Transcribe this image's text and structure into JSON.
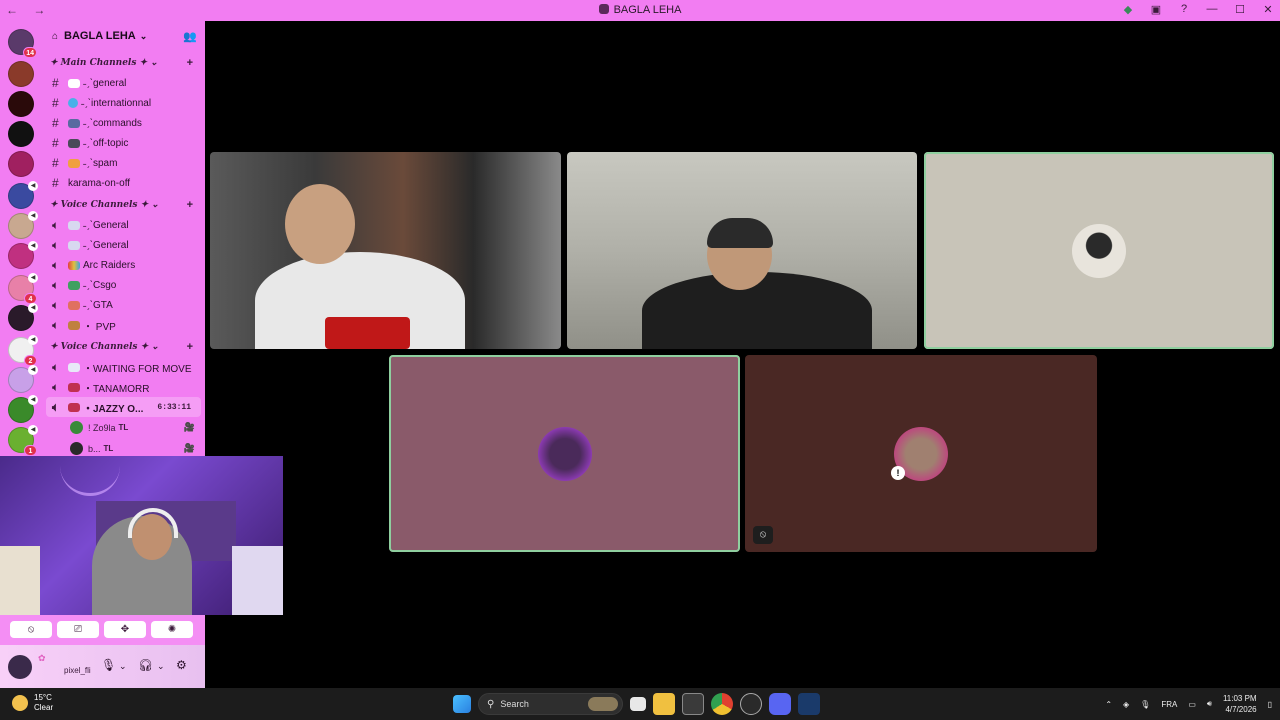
{
  "window": {
    "nav": "← →",
    "title": "BAGLA LEHA",
    "controls": [
      "—",
      "☐",
      "✕"
    ]
  },
  "server": {
    "name": "BAGLA LEHA",
    "categories": [
      {
        "label": "✦ Main Channels ✦ ⌄",
        "channels": [
          {
            "type": "text",
            "name": "˗ˏˋgeneral",
            "emoji_color": "#ffffff"
          },
          {
            "type": "text",
            "name": "˗ˏˋinternationnal",
            "emoji_color": "#4ab0e8"
          },
          {
            "type": "text",
            "name": "˗ˏˋcommands",
            "emoji_color": "#5a6aa0"
          },
          {
            "type": "text",
            "name": "˗ˏˋoff-topic",
            "emoji_color": "#4a4a5a"
          },
          {
            "type": "text",
            "name": "˗ˏˋspam",
            "emoji_color": "#f0a040"
          },
          {
            "type": "text",
            "name": "karama-on-off",
            "emoji_color": ""
          }
        ]
      },
      {
        "label": "✦ Voice Channels ✦ ⌄",
        "channels": [
          {
            "type": "voice",
            "name": "˗ˏˋGeneral",
            "emoji_color": "#d8d8f0"
          },
          {
            "type": "voice",
            "name": "˗ˏˋGeneral",
            "emoji_color": "#d8d8f0"
          },
          {
            "type": "voice",
            "name": " Arc Raiders",
            "emoji_color": "#e0a040"
          },
          {
            "type": "voice",
            "name": "˗ˏˋCsgo",
            "emoji_color": "#40a060"
          },
          {
            "type": "voice",
            "name": "˗ˏˋGTA",
            "emoji_color": "#e07060"
          },
          {
            "type": "voice",
            "name": "・ PVP",
            "emoji_color": "#c08040"
          }
        ]
      },
      {
        "label": "✦ Voice Channels ✦ ⌄",
        "channels": [
          {
            "type": "voice",
            "name": "・WAITING FOR MOVE",
            "emoji_color": "#e8e8f8"
          },
          {
            "type": "voice",
            "name": "・TANAMORR",
            "emoji_color": "#c03050"
          },
          {
            "type": "voice",
            "name": "・JAZZY O...",
            "emoji_color": "#c03050",
            "active": true,
            "timer": "6:33:11"
          }
        ]
      }
    ],
    "voice_users": [
      {
        "name": "! Zo9la",
        "tag": "TL",
        "camera": "🎥"
      },
      {
        "name": "b...",
        "tag": "TL",
        "camera": "🎥"
      }
    ]
  },
  "guild_badges": {
    "dm": "14",
    "g13": "4",
    "g16": "2",
    "g18": "1"
  },
  "user_panel": {
    "username": "pixel_fli",
    "buttons": [
      "⦸",
      "⎚",
      "✥",
      "✺"
    ]
  },
  "taskbar": {
    "weather_temp": "15°C",
    "weather_desc": "Clear",
    "search_placeholder": "Search",
    "language": "FRA",
    "time": "11:03 PM",
    "date": "4/7/2026"
  },
  "colors": {
    "accent": "#f27df2",
    "speaking_outline": "#8fcf9f",
    "tile_mauve": "#8a5a6a",
    "tile_brown": "#4a2824",
    "tile_beige": "#c8c4b8"
  }
}
